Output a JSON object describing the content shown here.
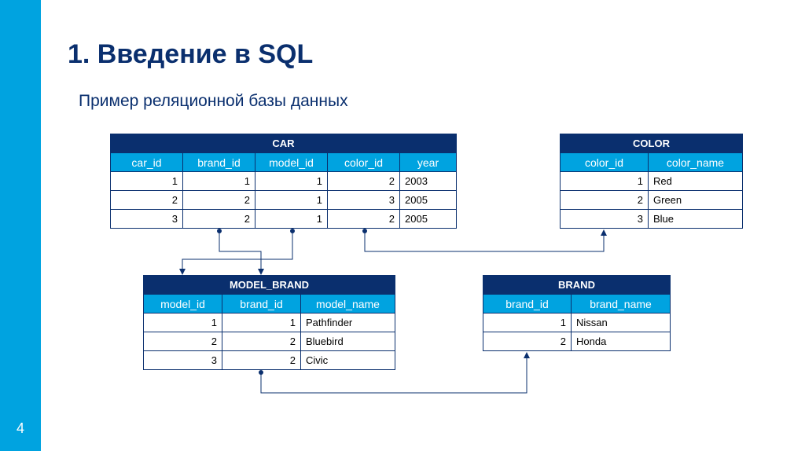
{
  "page": {
    "title": "1. Введение в SQL",
    "subtitle": "Пример реляционной базы данных",
    "pageNumber": "4"
  },
  "tables": {
    "car": {
      "name": "CAR",
      "columns": [
        "car_id",
        "brand_id",
        "model_id",
        "color_id",
        "year"
      ],
      "rows": [
        [
          "1",
          "1",
          "1",
          "2",
          "2003"
        ],
        [
          "2",
          "2",
          "1",
          "3",
          "2005"
        ],
        [
          "3",
          "2",
          "1",
          "2",
          "2005"
        ]
      ]
    },
    "color": {
      "name": "COLOR",
      "columns": [
        "color_id",
        "color_name"
      ],
      "rows": [
        [
          "1",
          "Red"
        ],
        [
          "2",
          "Green"
        ],
        [
          "3",
          "Blue"
        ]
      ]
    },
    "model_brand": {
      "name": "MODEL_BRAND",
      "columns": [
        "model_id",
        "brand_id",
        "model_name"
      ],
      "rows": [
        [
          "1",
          "1",
          "Pathfinder"
        ],
        [
          "2",
          "2",
          "Bluebird"
        ],
        [
          "3",
          "2",
          "Civic"
        ]
      ]
    },
    "brand": {
      "name": "BRAND",
      "columns": [
        "brand_id",
        "brand_name"
      ],
      "rows": [
        [
          "1",
          "Nissan"
        ],
        [
          "2",
          "Honda"
        ]
      ]
    }
  }
}
